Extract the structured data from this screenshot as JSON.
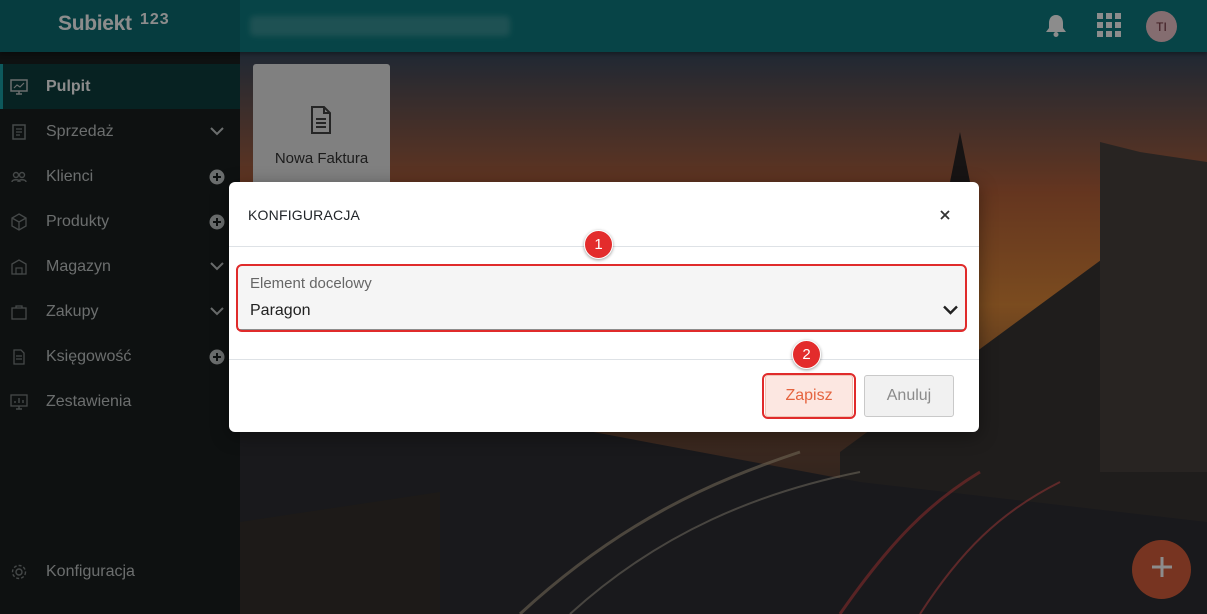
{
  "app": {
    "brand_name": "Subiekt",
    "brand_version": "123",
    "avatar_initials": "TI"
  },
  "sidebar": {
    "items": [
      {
        "label": "Pulpit",
        "icon": "desktop-icon",
        "right": "",
        "active": true
      },
      {
        "label": "Sprzedaż",
        "icon": "sales-icon",
        "right": "chevron-down-icon"
      },
      {
        "label": "Klienci",
        "icon": "clients-icon",
        "right": "plus-circle-icon"
      },
      {
        "label": "Produkty",
        "icon": "box-icon",
        "right": "plus-circle-icon"
      },
      {
        "label": "Magazyn",
        "icon": "warehouse-icon",
        "right": "chevron-down-icon"
      },
      {
        "label": "Zakupy",
        "icon": "purchases-icon",
        "right": "chevron-down-icon"
      },
      {
        "label": "Księgowość",
        "icon": "document-icon",
        "right": "plus-circle-icon"
      },
      {
        "label": "Zestawienia",
        "icon": "report-icon",
        "right": ""
      }
    ],
    "footer_label": "Konfiguracja"
  },
  "dashboard": {
    "tile_label": "Nowa Faktura"
  },
  "dialog": {
    "title": "KONFIGURACJA",
    "close_symbol": "×",
    "field_label": "Element docelowy",
    "field_value": "Paragon",
    "save_label": "Zapisz",
    "cancel_label": "Anuluj",
    "marker_1": "1",
    "marker_2": "2"
  },
  "colors": {
    "topbar": "#0d7d82",
    "sidebar": "#1a1f1f",
    "accent": "#e5643f",
    "highlight": "#e02b2b"
  }
}
